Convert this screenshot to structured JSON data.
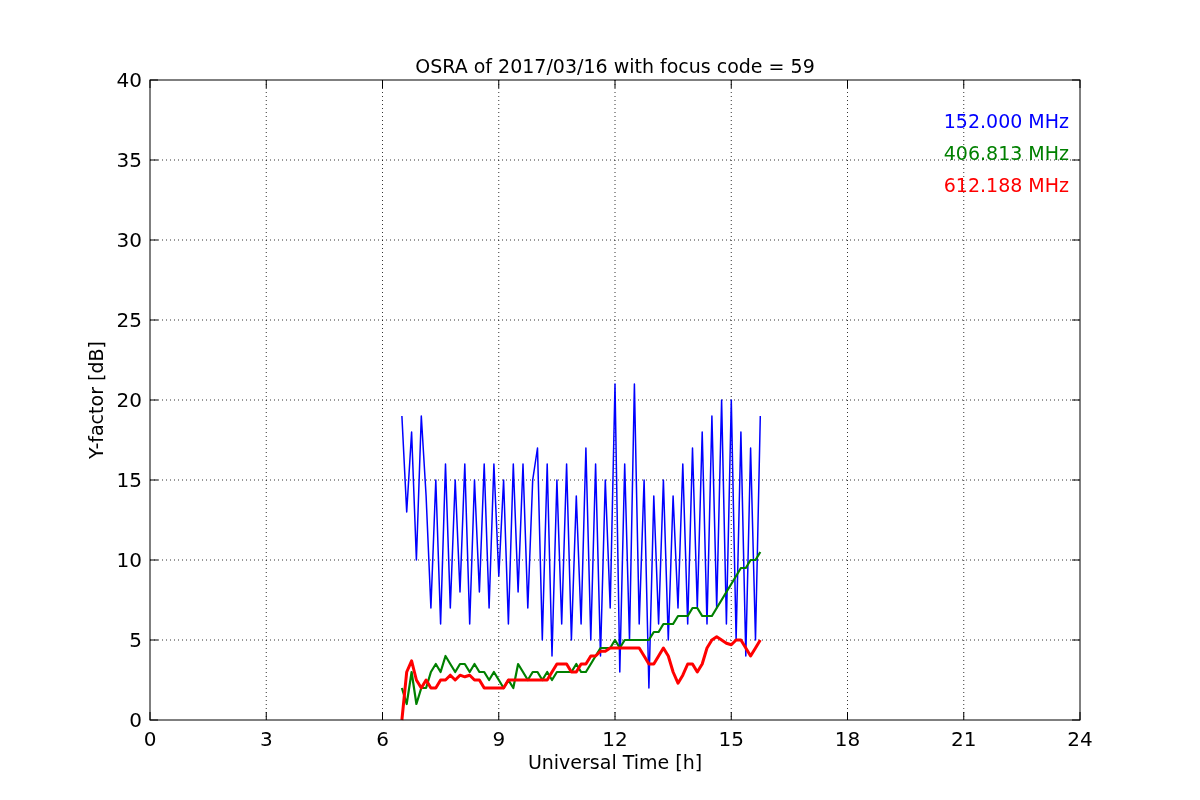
{
  "chart_data": {
    "type": "line",
    "title": "OSRA of 2017/03/16 with focus code = 59",
    "xlabel": "Universal Time [h]",
    "ylabel": "Y-factor [dB]",
    "x": [
      6.5,
      6.625,
      6.75,
      6.875,
      7,
      7.125,
      7.25,
      7.375,
      7.5,
      7.625,
      7.75,
      7.875,
      8,
      8.125,
      8.25,
      8.375,
      8.5,
      8.625,
      8.75,
      8.875,
      9,
      9.125,
      9.25,
      9.375,
      9.5,
      9.625,
      9.75,
      9.875,
      10,
      10.125,
      10.25,
      10.375,
      10.5,
      10.625,
      10.75,
      10.875,
      11,
      11.125,
      11.25,
      11.375,
      11.5,
      11.625,
      11.75,
      11.875,
      12,
      12.125,
      12.25,
      12.375,
      12.5,
      12.625,
      12.75,
      12.875,
      13,
      13.125,
      13.25,
      13.375,
      13.5,
      13.625,
      13.75,
      13.875,
      14,
      14.125,
      14.25,
      14.375,
      14.5,
      14.625,
      14.75,
      14.875,
      15,
      15.125,
      15.25,
      15.375,
      15.5,
      15.625,
      15.75
    ],
    "series": [
      {
        "name": "152.000 MHz",
        "color": "#0000ff",
        "values": [
          19,
          13,
          18,
          10,
          19,
          14,
          7,
          15,
          6,
          16,
          7,
          15,
          8,
          16,
          6,
          15,
          8,
          16,
          7,
          16,
          9,
          15,
          6,
          16,
          8,
          16,
          7,
          15,
          17,
          5,
          16,
          4,
          15,
          6,
          16,
          5,
          14,
          6,
          17,
          5,
          16,
          4,
          15,
          7,
          21,
          3,
          16,
          5,
          21,
          6,
          15,
          2,
          14,
          6,
          15,
          5,
          14,
          7,
          16,
          6,
          17,
          7,
          18,
          6,
          19,
          7,
          20,
          6,
          20,
          5,
          18,
          4,
          17,
          5,
          19
        ]
      },
      {
        "name": "406.813 MHz",
        "color": "#008000",
        "values": [
          2,
          1,
          3,
          1,
          2,
          2,
          3,
          3.5,
          3,
          4,
          3.5,
          3,
          3.5,
          3.5,
          3,
          3.5,
          3,
          3,
          2.5,
          3,
          2.5,
          2,
          2.5,
          2,
          3.5,
          3,
          2.5,
          3,
          3,
          2.5,
          3,
          2.5,
          3,
          3,
          3,
          3,
          3.5,
          3,
          3,
          3.5,
          4,
          4.5,
          4.5,
          4.5,
          5,
          4.5,
          5,
          5,
          5,
          5,
          5,
          5,
          5.5,
          5.5,
          6,
          6,
          6,
          6.5,
          6.5,
          6.5,
          7,
          7,
          6.5,
          6.5,
          6.5,
          7,
          7.5,
          8,
          8.5,
          9,
          9.5,
          9.5,
          10,
          10,
          10.5
        ]
      },
      {
        "name": "612.188 MHz",
        "color": "#ff0000",
        "values": [
          0,
          3,
          3.7,
          2.5,
          2,
          2.5,
          2,
          2,
          2.5,
          2.5,
          2.8,
          2.5,
          2.8,
          2.7,
          2.8,
          2.5,
          2.5,
          2,
          2,
          2,
          2,
          2,
          2.5,
          2.5,
          2.5,
          2.5,
          2.5,
          2.5,
          2.5,
          2.5,
          2.5,
          3,
          3.5,
          3.5,
          3.5,
          3,
          3,
          3.5,
          3.5,
          4,
          4,
          4.3,
          4.3,
          4.5,
          4.5,
          4.5,
          4.5,
          4.5,
          4.5,
          4.5,
          4,
          3.5,
          3.5,
          4,
          4.5,
          4,
          3,
          2.3,
          2.8,
          3.5,
          3.5,
          3,
          3.5,
          4.5,
          5,
          5.2,
          5,
          4.8,
          4.7,
          5,
          5,
          4.5,
          4,
          4.5,
          5
        ]
      }
    ],
    "grid": true,
    "xlim": [
      0,
      24
    ],
    "ylim": [
      0,
      40
    ],
    "xticks": [
      0,
      3,
      6,
      9,
      12,
      15,
      18,
      21,
      24
    ],
    "yticks": [
      0,
      5,
      10,
      15,
      20,
      25,
      30,
      35,
      40
    ]
  }
}
